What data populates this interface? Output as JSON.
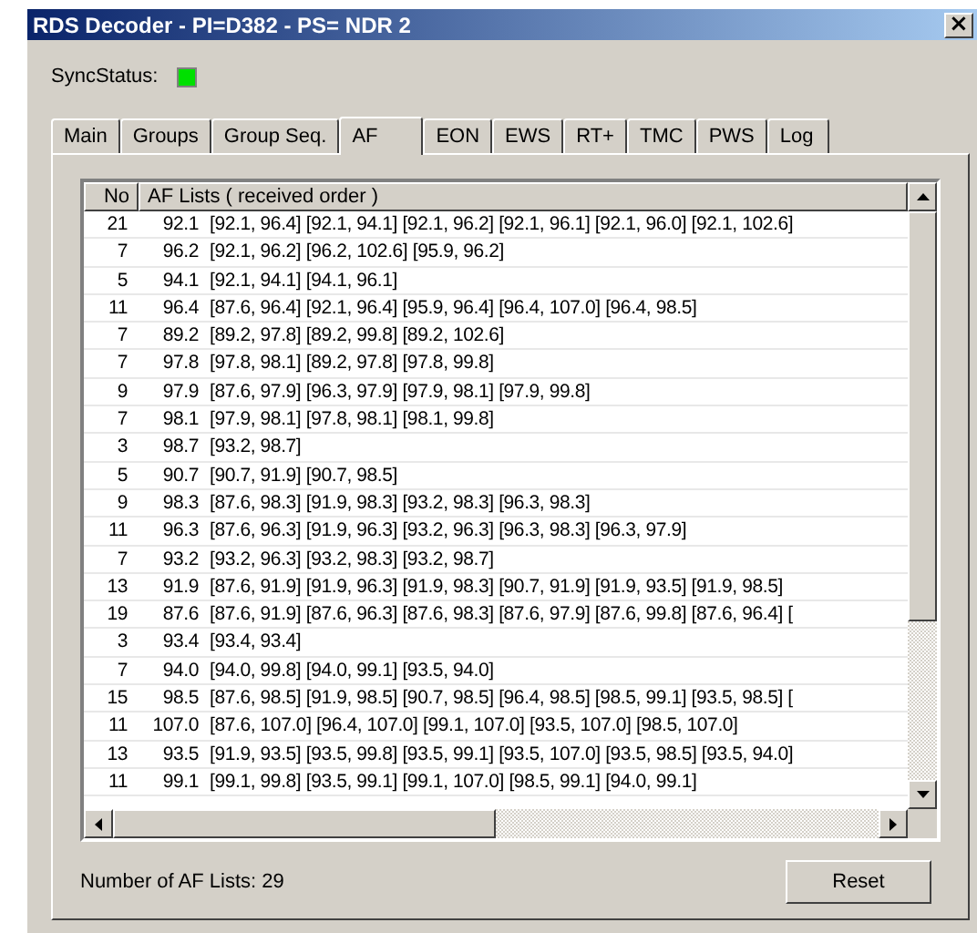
{
  "window": {
    "title": "RDS Decoder - PI=D382 - PS= NDR 2",
    "close": "×"
  },
  "sync_status": {
    "label": "SyncStatus:",
    "on": true
  },
  "tabs": [
    {
      "label": "Main",
      "selected": false
    },
    {
      "label": "Groups",
      "selected": false
    },
    {
      "label": "Group Seq.",
      "selected": false
    },
    {
      "label": "AF",
      "selected": true
    },
    {
      "label": "EON",
      "selected": false
    },
    {
      "label": "EWS",
      "selected": false
    },
    {
      "label": "RT+",
      "selected": false
    },
    {
      "label": "TMC",
      "selected": false
    },
    {
      "label": "PWS",
      "selected": false
    },
    {
      "label": "Log",
      "selected": false
    }
  ],
  "table": {
    "columns": [
      "No",
      "AF Lists ( received order )"
    ],
    "rows": [
      {
        "no": "21",
        "freq": "92.1",
        "lists": "[92.1, 96.4] [92.1, 94.1] [92.1, 96.2] [92.1, 96.1] [92.1, 96.0] [92.1, 102.6]"
      },
      {
        "no": "7",
        "freq": "96.2",
        "lists": "[92.1, 96.2] [96.2, 102.6] [95.9, 96.2]"
      },
      {
        "no": "5",
        "freq": "94.1",
        "lists": "[92.1, 94.1] [94.1, 96.1]"
      },
      {
        "no": "11",
        "freq": "96.4",
        "lists": "[87.6, 96.4] [92.1, 96.4] [95.9, 96.4] [96.4, 107.0] [96.4, 98.5]"
      },
      {
        "no": "7",
        "freq": "89.2",
        "lists": "[89.2, 97.8] [89.2, 99.8] [89.2, 102.6]"
      },
      {
        "no": "7",
        "freq": "97.8",
        "lists": "[97.8, 98.1] [89.2, 97.8] [97.8, 99.8]"
      },
      {
        "no": "9",
        "freq": "97.9",
        "lists": "[87.6, 97.9] [96.3, 97.9] [97.9, 98.1] [97.9, 99.8]"
      },
      {
        "no": "7",
        "freq": "98.1",
        "lists": "[97.9, 98.1] [97.8, 98.1] [98.1, 99.8]"
      },
      {
        "no": "3",
        "freq": "98.7",
        "lists": "[93.2, 98.7]"
      },
      {
        "no": "5",
        "freq": "90.7",
        "lists": "[90.7, 91.9] [90.7, 98.5]"
      },
      {
        "no": "9",
        "freq": "98.3",
        "lists": "[87.6, 98.3] [91.9, 98.3] [93.2, 98.3] [96.3, 98.3]"
      },
      {
        "no": "11",
        "freq": "96.3",
        "lists": "[87.6, 96.3] [91.9, 96.3] [93.2, 96.3] [96.3, 98.3] [96.3, 97.9]"
      },
      {
        "no": "7",
        "freq": "93.2",
        "lists": "[93.2, 96.3] [93.2, 98.3] [93.2, 98.7]"
      },
      {
        "no": "13",
        "freq": "91.9",
        "lists": "[87.6, 91.9] [91.9, 96.3] [91.9, 98.3] [90.7, 91.9] [91.9, 93.5] [91.9, 98.5]"
      },
      {
        "no": "19",
        "freq": "87.6",
        "lists": "[87.6, 91.9] [87.6, 96.3] [87.6, 98.3] [87.6, 97.9] [87.6, 99.8] [87.6, 96.4] ["
      },
      {
        "no": "3",
        "freq": "93.4",
        "lists": "[93.4, 93.4]"
      },
      {
        "no": "7",
        "freq": "94.0",
        "lists": "[94.0, 99.8] [94.0, 99.1] [93.5, 94.0]"
      },
      {
        "no": "15",
        "freq": "98.5",
        "lists": "[87.6, 98.5] [91.9, 98.5] [90.7, 98.5] [96.4, 98.5] [98.5, 99.1] [93.5, 98.5] ["
      },
      {
        "no": "11",
        "freq": "107.0",
        "lists": "[87.6, 107.0] [96.4, 107.0] [99.1, 107.0] [93.5, 107.0] [98.5, 107.0]"
      },
      {
        "no": "13",
        "freq": "93.5",
        "lists": "[91.9, 93.5] [93.5, 99.8] [93.5, 99.1] [93.5, 107.0] [93.5, 98.5] [93.5, 94.0]"
      },
      {
        "no": "11",
        "freq": "99.1",
        "lists": "[99.1, 99.8] [93.5, 99.1] [99.1, 107.0] [98.5, 99.1] [94.0, 99.1]"
      }
    ]
  },
  "count_label": "Number of AF Lists: 29",
  "buttons": [
    "Reset"
  ]
}
